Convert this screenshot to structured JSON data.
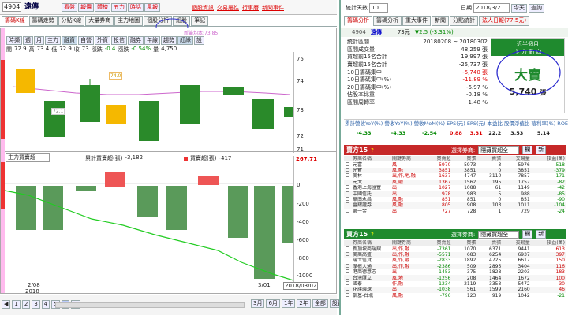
{
  "top": {
    "num": "4904",
    "name": "遠傳",
    "links": [
      "看盤",
      "報價",
      "體檢",
      "五力",
      "時話",
      "風報"
    ],
    "right_links": [
      "個股資訊",
      "交易屬性",
      "行事曆",
      "新聞事件"
    ],
    "date_label": "統計天數",
    "days": "10",
    "date_field": "日期",
    "date": "2018/3/2",
    "today": "今天",
    "query": "查詢"
  },
  "chart_tabs": [
    "籌碼K線",
    "籌碼走勢",
    "分點K線",
    "大量券商",
    "主力地圖",
    "個股分析",
    "細股",
    "筆記"
  ],
  "chart_btns": [
    "時頻",
    "週",
    "月",
    "主力",
    "融資",
    "自營",
    "外資",
    "投信",
    "融券",
    "年線",
    "趨勢",
    "紅綠",
    "設"
  ],
  "ohlc": {
    "o_l": "開",
    "o": "72.9",
    "h_l": "高",
    "h": "73.4",
    "l_l": "低",
    "l": "72.9",
    "c_l": "收",
    "c": "73",
    "chg_l": "漲跌",
    "chg": "-0.4",
    "pct_l": "漲跌",
    "pct": "-0.54%",
    "vol_l": "量",
    "vol": "4,750"
  },
  "ma_label": "新籌均本:73.85",
  "price_axis": [
    "75",
    "74",
    "73",
    "72",
    "71"
  ],
  "price_labels": [
    "74.0",
    "72.1"
  ],
  "main_select": "主力買賣超",
  "legend": {
    "buy": "一累計買賣超(張)",
    "buy_val": "-3,182",
    "sell": "買賣超(張)",
    "sell_val": "-417"
  },
  "vol_axis": [
    "267.71",
    "0",
    "-200",
    "-400",
    "-600",
    "-800",
    "-1000"
  ],
  "x_axis": {
    "start": "2/08",
    "year": "2018",
    "mid": "3/01",
    "end": "2018/03/02"
  },
  "nav": {
    "pages": [
      "1",
      "2",
      "3",
      "4",
      "5",
      "6"
    ],
    "periods": [
      "3月",
      "6月",
      "1年",
      "2年",
      "全部",
      "設置"
    ]
  },
  "right_tabs": [
    "籌碼分析",
    "籌碼分析",
    "重大事件",
    "新聞",
    "分點統計",
    "法人日報(77.5元)"
  ],
  "stock": {
    "num": "4904",
    "name": "遠傳",
    "price": "73元",
    "change": "▼2.5 (-3.31%)"
  },
  "summary": {
    "rows": [
      {
        "k": "統計區間",
        "v": "20180208 ~ 20180302"
      },
      {
        "k": "區間成交量",
        "v": "48,259 張"
      },
      {
        "k": "買超前15名合計",
        "v": "19,997 張"
      },
      {
        "k": "賣超前15名合計",
        "v": "-25,737 張"
      },
      {
        "k": "10日籌碼集中",
        "v": "-5,740 張"
      },
      {
        "k": "10日籌碼集中(%)",
        "v": "-11.89 %"
      },
      {
        "k": "20日籌碼集中(%)",
        "v": "-6.97 %"
      },
      {
        "k": "佔股本比重",
        "v": "-0.18 %"
      },
      {
        "k": "區間周轉率",
        "v": "1.48 %"
      }
    ]
  },
  "box": {
    "title": "近半個月",
    "subtitle": "主 力 動 向",
    "status": "大賣",
    "value": "5,740",
    "unit": "張"
  },
  "metrics": {
    "headers": [
      "累計營收YoY(%)",
      "營收YoY(%)",
      "營收MoM(%)",
      "EPS(元)",
      "EPS(元)",
      "本益比",
      "股價淨值比",
      "殖利率(%)",
      "ROE(近四季)"
    ],
    "values": [
      "-4.33",
      "-4.33",
      "-2.54",
      "0.88",
      "3.31",
      "22.2",
      "3.53",
      "5.14",
      "16"
    ]
  },
  "sell_section": {
    "title": "賣方15",
    "help": "?",
    "filter": "選擇券商:",
    "filter_val": "隱藏買超全",
    "btn1": "欄",
    "btn2": "新"
  },
  "buy_section": {
    "title": "買方15",
    "help": "?",
    "filter": "選擇券商:",
    "filter_val": "隱藏買超全",
    "btn1": "欄",
    "btn2": "新"
  },
  "ftable_headers": [
    "券商名稱",
    "關鍵券商",
    "買賣超",
    "買張",
    "賣張",
    "交易量",
    "損益(萬)"
  ],
  "sell_rows": [
    [
      "元富",
      "風",
      "5970",
      "5973",
      "3",
      "5976",
      "-518"
    ],
    [
      "光寶",
      "風,融",
      "3851",
      "3851",
      "0",
      "3851",
      "-379"
    ],
    [
      "美林",
      "出,作,地,融",
      "1637",
      "4747",
      "3110",
      "7857",
      "-171"
    ],
    [
      "元大",
      "風,融",
      "1367",
      "1562",
      "195",
      "1757",
      "-82"
    ],
    [
      "香港上海匯豐",
      "出",
      "1027",
      "1088",
      "61",
      "1149",
      "-42"
    ],
    [
      "中國信託",
      "出",
      "978",
      "983",
      "5",
      "988",
      "-85"
    ],
    [
      "華南永昌",
      "風,融",
      "851",
      "851",
      "0",
      "851",
      "-90"
    ],
    [
      "臺銀證券",
      "風,融",
      "805",
      "908",
      "103",
      "1011",
      "-104"
    ],
    [
      "第一金",
      "出",
      "727",
      "728",
      "1",
      "729",
      "-24"
    ]
  ],
  "buy_rows": [
    [
      "新加坡商瑞銀",
      "出,作,融",
      "-7361",
      "1070",
      "6371",
      "9441",
      "613"
    ],
    [
      "美商高盛",
      "出,作,融",
      "-5571",
      "683",
      "6254",
      "6937",
      "397"
    ],
    [
      "瑞士信貸",
      "風,作,融",
      "-2833",
      "1892",
      "4725",
      "6617",
      "150"
    ],
    [
      "摩根大通",
      "出,作,融",
      "-2386",
      "509",
      "2895",
      "3404",
      "116"
    ],
    [
      "港商德意志",
      "出",
      "-1453",
      "375",
      "1828",
      "2203",
      "183"
    ],
    [
      "台灣匯立",
      "風,地",
      "-1256",
      "208",
      "1464",
      "1672",
      "100"
    ],
    [
      "國泰",
      "作,融",
      "-1234",
      "2119",
      "3353",
      "5472",
      "30"
    ],
    [
      "花旗環球",
      "出",
      "-1038",
      "561",
      "1599",
      "2160",
      "46"
    ],
    [
      "凱基-台北",
      "風,融",
      "-796",
      "123",
      "919",
      "1042",
      "-21"
    ]
  ]
}
